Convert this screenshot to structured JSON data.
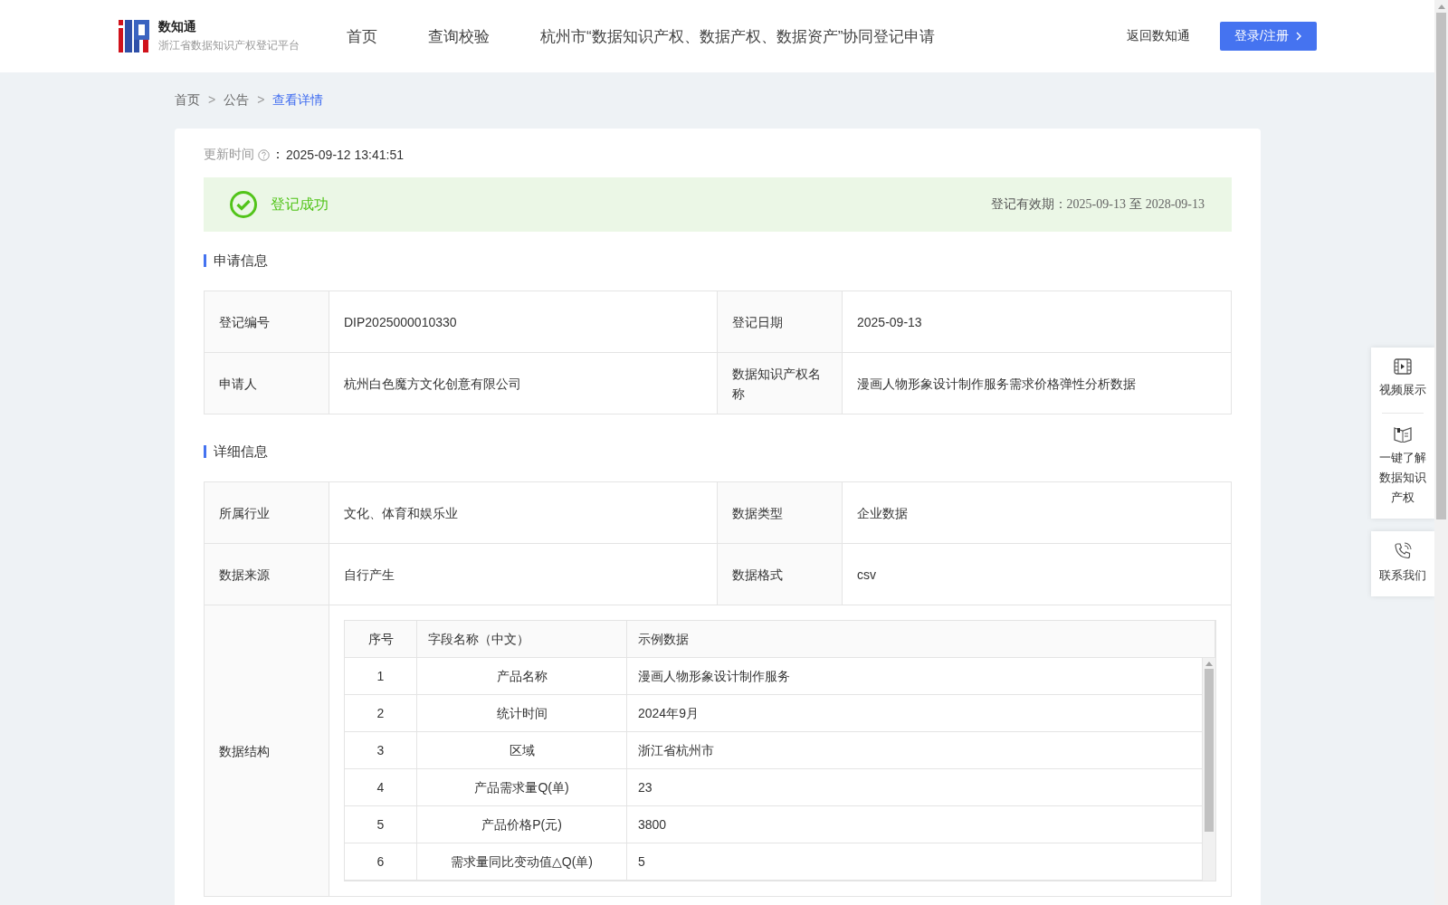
{
  "header": {
    "brand": "数知通",
    "subtitle": "浙江省数据知识产权登记平台",
    "nav": [
      {
        "label": "首页",
        "selected": false
      },
      {
        "label": "查询校验",
        "selected": false
      },
      {
        "label": "杭州市“数据知识产权、数据产权、数据资产”协同登记申请",
        "selected": false
      }
    ],
    "back_link": "返回数知通",
    "login_button": "登录/注册"
  },
  "breadcrumb": [
    {
      "label": "首页",
      "selected": false
    },
    {
      "label": "公告",
      "selected": false
    },
    {
      "label": "查看详情",
      "selected": true
    }
  ],
  "breadcrumb_separators": [
    ">",
    ">"
  ],
  "update": {
    "label": "更新时间",
    "colon": "：",
    "value": "2025-09-12 13:41:51"
  },
  "status": {
    "text": "登记成功",
    "validity_label": "登记有效期：",
    "validity_from": "2025-09-13",
    "validity_sep": "至",
    "validity_to": "2028-09-13"
  },
  "sections": [
    {
      "title": "申请信息",
      "rows": [
        [
          {
            "label": "登记编号",
            "value": "DIP2025000010330"
          },
          {
            "label": "登记日期",
            "value": "2025-09-13"
          }
        ],
        [
          {
            "label": "申请人",
            "value": "杭州白色魔方文化创意有限公司"
          },
          {
            "label": "数据知识产权名称",
            "value": "漫画人物形象设计制作服务需求价格弹性分析数据"
          }
        ]
      ]
    },
    {
      "title": "详细信息",
      "rows": [
        [
          {
            "label": "所属行业",
            "value": "文化、体育和娱乐业"
          },
          {
            "label": "数据类型",
            "value": "企业数据"
          }
        ],
        [
          {
            "label": "数据来源",
            "value": "自行产生"
          },
          {
            "label": "数据格式",
            "value": "csv"
          }
        ]
      ],
      "structure": {
        "label": "数据结构",
        "columns": [
          "序号",
          "字段名称（中文）",
          "示例数据"
        ],
        "rows": [
          [
            "1",
            "产品名称",
            "漫画人物形象设计制作服务"
          ],
          [
            "2",
            "统计时间",
            "2024年9月"
          ],
          [
            "3",
            "区域",
            "浙江省杭州市"
          ],
          [
            "4",
            "产品需求量Q(单)",
            "23"
          ],
          [
            "5",
            "产品价格P(元)",
            "3800"
          ],
          [
            "6",
            "需求量同比变动值△Q(单)",
            "5"
          ]
        ]
      }
    }
  ],
  "float_panel": [
    {
      "label": "视频展示",
      "kind": "video"
    },
    {
      "label": "一键了解数据知识产权",
      "kind": "book"
    },
    {
      "label": "联系我们",
      "kind": "phone"
    }
  ]
}
